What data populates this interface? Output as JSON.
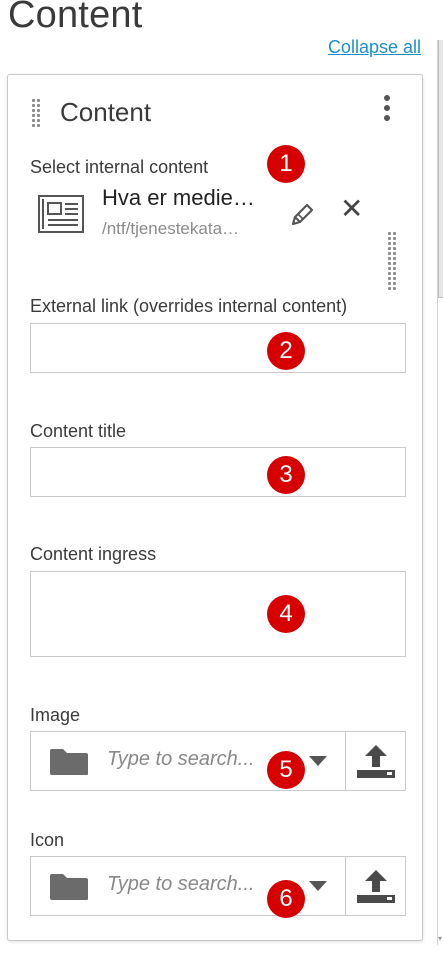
{
  "page": {
    "title": "Content",
    "collapse_all": "Collapse all"
  },
  "panel": {
    "title": "Content",
    "menu_icon": "more-vertical-icon",
    "internal_content": {
      "label": "Select internal content",
      "item_name": "Hva er medie…",
      "item_path": "/ntf/tjenestekata…",
      "item_icon": "document-icon",
      "edit_icon": "pencil-icon",
      "remove_icon": "close-icon"
    },
    "external_link": {
      "label": "External link (overrides internal content)",
      "value": ""
    },
    "content_title": {
      "label": "Content title",
      "value": ""
    },
    "content_ingress": {
      "label": "Content ingress",
      "value": ""
    },
    "image": {
      "label": "Image",
      "placeholder": "Type to search...",
      "folder_icon": "folder-icon",
      "upload_icon": "upload-icon"
    },
    "icon": {
      "label": "Icon",
      "placeholder": "Type to search...",
      "folder_icon": "folder-icon",
      "upload_icon": "upload-icon"
    }
  },
  "annotations": [
    "1",
    "2",
    "3",
    "4",
    "5",
    "6"
  ],
  "colors": {
    "link": "#1c8fc7",
    "badge": "#d60000",
    "border": "#c8c8c8",
    "icon": "#555555"
  }
}
